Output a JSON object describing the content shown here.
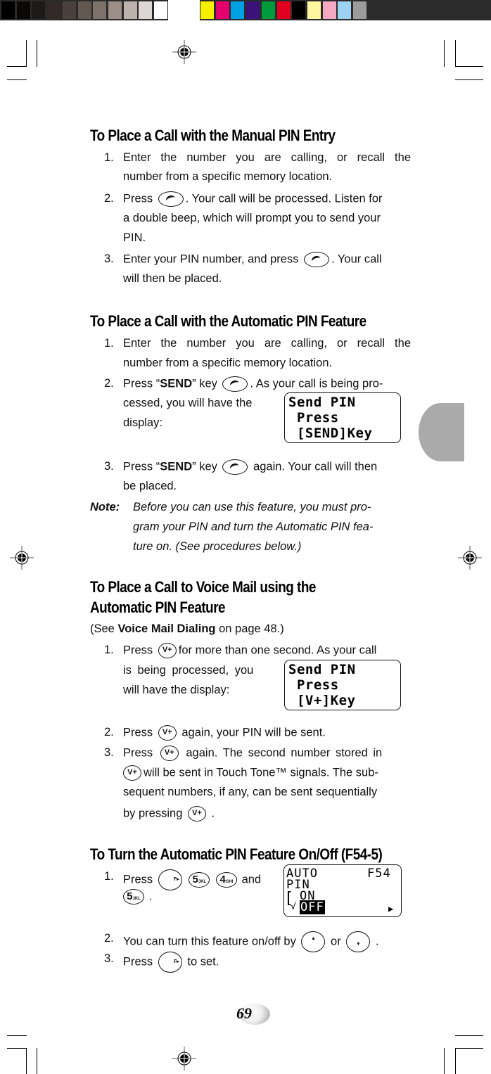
{
  "color_bar": {
    "grays": [
      "#000000",
      "#0b0808",
      "#1d1a18",
      "#332a27",
      "#4a413c",
      "#625850",
      "#7d726b",
      "#9b8f88",
      "#bcb2ab",
      "#dcd7d3",
      "#ffffff"
    ],
    "colors": [
      "#f7ee00",
      "#e4006d",
      "#00a0e5",
      "#3b1279",
      "#009a3e",
      "#e1001f",
      "#000000",
      "#fff6a0",
      "#f4a8c2",
      "#9dd2f2",
      "#9c9c9c"
    ]
  },
  "section1": {
    "heading": "To Place a Call with the Manual PIN Entry",
    "steps": [
      {
        "num": "1.",
        "l1": "Enter the number you are calling, or recall the",
        "l2": "number from a specific memory location."
      },
      {
        "num": "2.",
        "pre": "Press",
        "key": "send-key",
        "post": ". Your call will be processed. Listen for",
        "l2": "a double beep, which will prompt you to send your",
        "l3": "PIN."
      },
      {
        "num": "3.",
        "pre": "Enter your PIN number, and press",
        "key": "send-key",
        "post": ". Your call",
        "l2": "will then be placed."
      }
    ]
  },
  "section2": {
    "heading": "To Place a Call with the Automatic PIN Feature",
    "steps": [
      {
        "num": "1.",
        "l1": "Enter the number you are calling, or recall the",
        "l2": "number from a specific memory location."
      },
      {
        "num": "2.",
        "pre": "Press “",
        "bold": "SEND",
        "mid": "” key",
        "post": ". As your call is being pro-",
        "l2": "cessed, you will have the",
        "l3": "display:"
      },
      {
        "num": "3.",
        "pre": "Press “",
        "bold": "SEND",
        "mid": "” key",
        "post": "again. Your call will then",
        "l2": "be placed."
      }
    ],
    "lcd": [
      "Send PIN",
      " Press",
      " [SEND]Key"
    ],
    "note_label": "Note:",
    "note_lines": [
      "Before you can use this feature, you must pro-",
      "gram your PIN and turn the Automatic PIN fea-",
      "ture on. (See procedures below.)"
    ]
  },
  "section3": {
    "heading_l1": "To Place a Call to Voice Mail using the",
    "heading_l2": "Automatic PIN Feature",
    "see_pre": "(See ",
    "see_bold": "Voice Mail Dialing",
    "see_post": " on page 48.)",
    "key_label": "V+",
    "steps": [
      {
        "num": "1.",
        "pre": "Press",
        "post": "for more than one second. As your call",
        "l2": "is being processed, you",
        "l3": "will have the display:"
      },
      {
        "num": "2.",
        "pre": "Press",
        "post": "again, your PIN will be sent."
      },
      {
        "num": "3.",
        "pre": "Press",
        "post": "again. The second number stored in",
        "l2_post": "will be sent in Touch Tone™ signals. The sub-",
        "l3": "sequent numbers, if any, can be sent sequentially",
        "l4_pre": "by pressing",
        "l4_post": "."
      }
    ],
    "lcd": [
      "Send PIN",
      " Press",
      " [V+]Key"
    ]
  },
  "section4": {
    "heading": "To Turn the Automatic PIN Feature On/Off (F54-5)",
    "steps": [
      {
        "num": "1.",
        "pre": "Press",
        "and": "and",
        "end": "."
      },
      {
        "num": "2.",
        "pre": "You can turn this feature on/off by",
        "or": "or",
        "end": "."
      },
      {
        "num": "3.",
        "pre": "Press",
        "post": "to set."
      }
    ],
    "keys": {
      "f": "F▸",
      "k5_digit": "5",
      "k5_sub": "JKL",
      "k4_digit": "4",
      "k4_sub": "GHI",
      "up": "▲",
      "down": "▼"
    },
    "lcd": {
      "r1_left": "AUTO",
      "r1_right": "F54",
      "r2": "PIN",
      "r3": "ON",
      "r4_check": "√",
      "r4_selected": "OFF",
      "r4_arrow": "▶",
      "bracket": "["
    }
  },
  "page_number": "69"
}
